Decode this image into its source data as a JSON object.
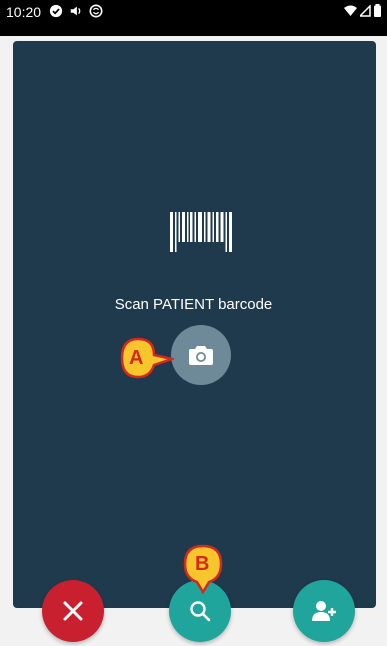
{
  "status_bar": {
    "time": "10:20",
    "icons": [
      "check-circle-icon",
      "volume-icon",
      "sync-circle-icon"
    ],
    "right_icons": [
      "wifi-icon",
      "cell-signal-icon",
      "battery-icon"
    ]
  },
  "scan": {
    "label": "Scan PATIENT barcode",
    "icon": "barcode-icon"
  },
  "buttons": {
    "camera_icon": "camera-icon",
    "cancel_icon": "close-icon",
    "search_icon": "search-icon",
    "add_icon": "add-person-icon"
  },
  "callouts": {
    "a": "A",
    "b": "B"
  },
  "colors": {
    "card": "#1e3a4c",
    "camera_button": "#6e8a98",
    "cancel": "#c8202f",
    "teal": "#1fa59c",
    "callout_fill": "#f7c62d",
    "callout_text": "#d42a1d"
  }
}
